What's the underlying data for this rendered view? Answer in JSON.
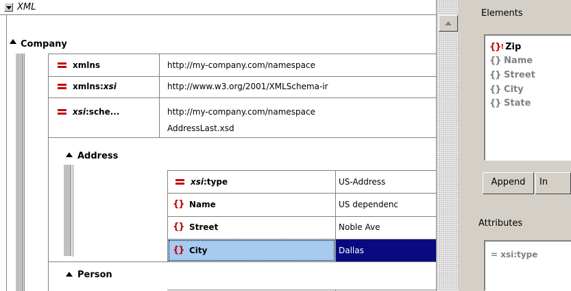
{
  "window": {
    "title": "XML"
  },
  "company": {
    "name": "Company",
    "attributes": [
      {
        "prefix": "",
        "name": "xmlns",
        "value": "http://my-company.com/namespace"
      },
      {
        "prefix": "xmlns:",
        "name": "xsi",
        "value": "http://www.w3.org/2001/XMLSchema-ir"
      },
      {
        "prefix": "xsi",
        "name": ":sche...",
        "value": "http://my-company.com/namespace",
        "value2": "AddressLast.xsd"
      }
    ]
  },
  "address": {
    "name": "Address",
    "rows": [
      {
        "kind": "attribute",
        "prefix": "xsi",
        "name": ":type",
        "value": "US-Address"
      },
      {
        "kind": "element",
        "name": "Name",
        "value": "US dependenc"
      },
      {
        "kind": "element",
        "name": "Street",
        "value": "Noble Ave"
      },
      {
        "kind": "element",
        "name": "City",
        "value": "Dallas"
      }
    ]
  },
  "person": {
    "name": "Person"
  },
  "elements_panel": {
    "title": "Elements",
    "items": [
      {
        "label": "Zip",
        "required": true
      },
      {
        "label": "Name",
        "required": false
      },
      {
        "label": "Street",
        "required": false
      },
      {
        "label": "City",
        "required": false
      },
      {
        "label": "State",
        "required": false
      }
    ],
    "buttons": {
      "append": "Append",
      "insert": "In"
    }
  },
  "attributes_panel": {
    "title": "Attributes",
    "items": [
      {
        "label": "xsi:type"
      }
    ]
  },
  "colors": {
    "selection_bg": "#0a0a80",
    "selection_light": "#a6caf0",
    "brace": "#c00000"
  }
}
